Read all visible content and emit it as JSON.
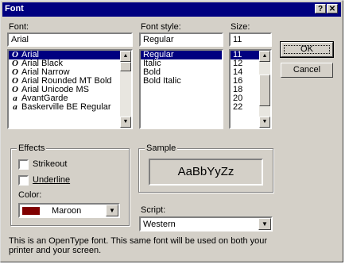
{
  "window": {
    "title": "Font",
    "help_label": "?",
    "close_label": "✕"
  },
  "font": {
    "label": "Font:",
    "value": "Arial",
    "items": [
      {
        "icon": "open-type-icon",
        "glyph": "O",
        "name": "Arial",
        "selected": true
      },
      {
        "icon": "open-type-icon",
        "glyph": "O",
        "name": "Arial Black"
      },
      {
        "icon": "open-type-icon",
        "glyph": "O",
        "name": "Arial Narrow"
      },
      {
        "icon": "open-type-icon",
        "glyph": "O",
        "name": "Arial Rounded MT Bold"
      },
      {
        "icon": "open-type-icon",
        "glyph": "O",
        "name": "Arial Unicode MS"
      },
      {
        "icon": "type1-font-icon",
        "glyph": "a",
        "name": "AvantGarde"
      },
      {
        "icon": "type1-font-icon",
        "glyph": "a",
        "name": "Baskerville BE Regular"
      }
    ]
  },
  "style": {
    "label": "Font style:",
    "value": "Regular",
    "items": [
      {
        "name": "Regular",
        "selected": true
      },
      {
        "name": "Italic"
      },
      {
        "name": "Bold"
      },
      {
        "name": "Bold Italic"
      }
    ]
  },
  "size": {
    "label": "Size:",
    "value": "11",
    "items": [
      {
        "name": "11",
        "selected": true
      },
      {
        "name": "12"
      },
      {
        "name": "14"
      },
      {
        "name": "16"
      },
      {
        "name": "18"
      },
      {
        "name": "20"
      },
      {
        "name": "22"
      }
    ]
  },
  "buttons": {
    "ok": "OK",
    "cancel": "Cancel"
  },
  "effects": {
    "label": "Effects",
    "strikeout": {
      "label": "Strikeout",
      "checked": false
    },
    "underline": {
      "label": "Underline",
      "checked": false
    },
    "color_label": "Color:",
    "color_value": "Maroon",
    "color_hex": "#800000"
  },
  "sample": {
    "label": "Sample",
    "text": "AaBbYyZz"
  },
  "script": {
    "label": "Script:",
    "value": "Western"
  },
  "description": {
    "line1": "This is an OpenType font. This same font will be used on both your",
    "line2": "printer and your screen."
  }
}
